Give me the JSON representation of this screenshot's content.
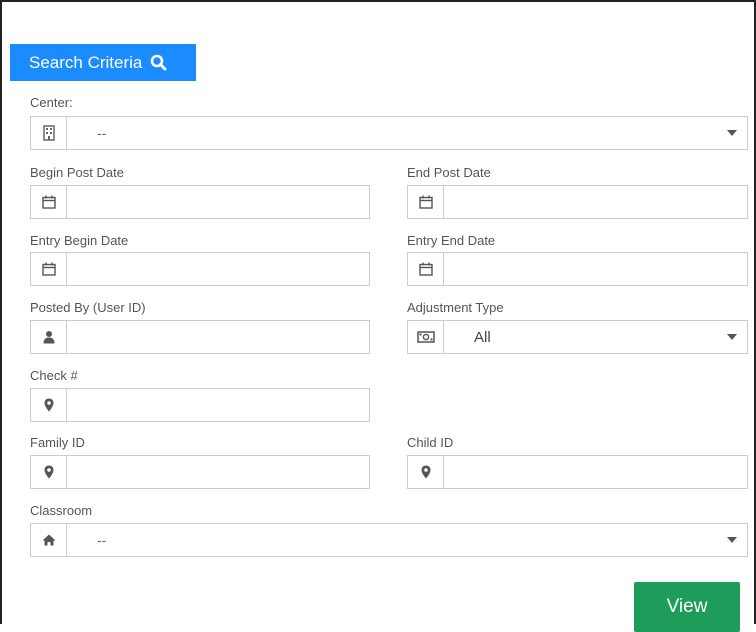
{
  "header": {
    "title": "Search Criteria"
  },
  "fields": {
    "center": {
      "label": "Center:",
      "value": "--"
    },
    "begin_post_date": {
      "label": "Begin Post Date",
      "value": ""
    },
    "end_post_date": {
      "label": "End Post Date",
      "value": ""
    },
    "entry_begin_date": {
      "label": "Entry Begin Date",
      "value": ""
    },
    "entry_end_date": {
      "label": "Entry End Date",
      "value": ""
    },
    "posted_by": {
      "label": "Posted By (User ID)",
      "value": ""
    },
    "adjustment_type": {
      "label": "Adjustment Type",
      "value": "All"
    },
    "check_num": {
      "label": "Check #",
      "value": ""
    },
    "family_id": {
      "label": "Family ID",
      "value": ""
    },
    "child_id": {
      "label": "Child ID",
      "value": ""
    },
    "classroom": {
      "label": "Classroom",
      "value": "--"
    }
  },
  "actions": {
    "view_label": "View"
  },
  "icons": {
    "center": "building-icon",
    "date": "calendar-icon",
    "user": "user-icon",
    "money": "money-icon",
    "location": "map-marker-icon",
    "home": "home-icon",
    "search": "search-icon",
    "caret": "caret-down-icon"
  },
  "colors": {
    "header_bg": "#1a8cff",
    "view_button_bg": "#1e9c5a",
    "border": "#cccccc"
  }
}
